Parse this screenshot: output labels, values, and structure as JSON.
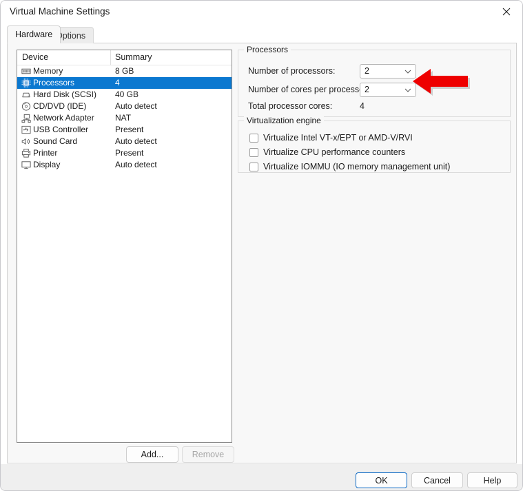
{
  "window": {
    "title": "Virtual Machine Settings",
    "close_icon": "close-icon"
  },
  "tabs": [
    {
      "label": "Hardware",
      "active": true
    },
    {
      "label": "Options",
      "active": false
    }
  ],
  "device_list": {
    "columns": [
      "Device",
      "Summary"
    ],
    "rows": [
      {
        "icon": "memory-icon",
        "device": "Memory",
        "summary": "8 GB",
        "selected": false
      },
      {
        "icon": "processor-icon",
        "device": "Processors",
        "summary": "4",
        "selected": true
      },
      {
        "icon": "hard-disk-icon",
        "device": "Hard Disk (SCSI)",
        "summary": "40 GB",
        "selected": false
      },
      {
        "icon": "cd-dvd-icon",
        "device": "CD/DVD (IDE)",
        "summary": "Auto detect",
        "selected": false
      },
      {
        "icon": "network-adapter-icon",
        "device": "Network Adapter",
        "summary": "NAT",
        "selected": false
      },
      {
        "icon": "usb-controller-icon",
        "device": "USB Controller",
        "summary": "Present",
        "selected": false
      },
      {
        "icon": "sound-card-icon",
        "device": "Sound Card",
        "summary": "Auto detect",
        "selected": false
      },
      {
        "icon": "printer-icon",
        "device": "Printer",
        "summary": "Present",
        "selected": false
      },
      {
        "icon": "display-icon",
        "device": "Display",
        "summary": "Auto detect",
        "selected": false
      }
    ]
  },
  "device_buttons": {
    "add_label": "Add...",
    "remove_label": "Remove",
    "remove_disabled": true
  },
  "processors_group": {
    "title": "Processors",
    "number_of_processors_label": "Number of processors:",
    "number_of_processors_value": "2",
    "cores_per_processor_label": "Number of cores per processor:",
    "cores_per_processor_value": "2",
    "total_cores_label": "Total processor cores:",
    "total_cores_value": "4"
  },
  "virtualization_group": {
    "title": "Virtualization engine",
    "options": [
      {
        "label": "Virtualize Intel VT-x/EPT or AMD-V/RVI",
        "checked": false
      },
      {
        "label": "Virtualize CPU performance counters",
        "checked": false
      },
      {
        "label": "Virtualize IOMMU (IO memory management unit)",
        "checked": false
      }
    ]
  },
  "annotation": {
    "arrow": "left-arrow-annotation",
    "color": "#ee0000"
  },
  "footer": {
    "ok_label": "OK",
    "cancel_label": "Cancel",
    "help_label": "Help"
  },
  "colors": {
    "selection_blue": "#0b78d0",
    "focus_blue": "#0a68c4",
    "panel_bg": "#f8f8f8",
    "footer_bg": "#efefef"
  }
}
